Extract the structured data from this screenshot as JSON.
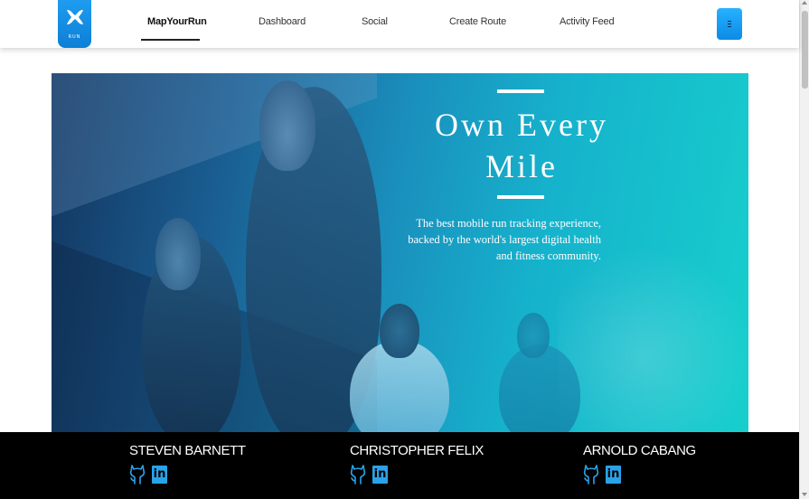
{
  "logo": {
    "text": "RUN",
    "mark": "UA"
  },
  "nav": {
    "links": [
      {
        "label": "MapYourRun",
        "active": true
      },
      {
        "label": "Dashboard",
        "active": false
      },
      {
        "label": "Social",
        "active": false
      },
      {
        "label": "Create Route",
        "active": false
      },
      {
        "label": "Activity Feed",
        "active": false
      }
    ],
    "menu_icon": "hamburger-icon"
  },
  "hero": {
    "title": "Own Every Mile",
    "subtitle": "The best mobile run tracking experience, backed by the world's largest digital health and fitness community."
  },
  "footer": {
    "members": [
      {
        "name": "STEVEN BARNETT",
        "icons": [
          "github-icon",
          "linkedin-icon"
        ]
      },
      {
        "name": "CHRISTOPHER FELIX",
        "icons": [
          "github-icon",
          "linkedin-icon"
        ]
      },
      {
        "name": "ARNOLD CABANG",
        "icons": [
          "github-icon",
          "linkedin-icon"
        ]
      }
    ]
  },
  "colors": {
    "accent": "#1e9cf0",
    "hero_gradient_start": "#13355f",
    "hero_gradient_end": "#17cfcd",
    "footer_bg": "#000000"
  }
}
